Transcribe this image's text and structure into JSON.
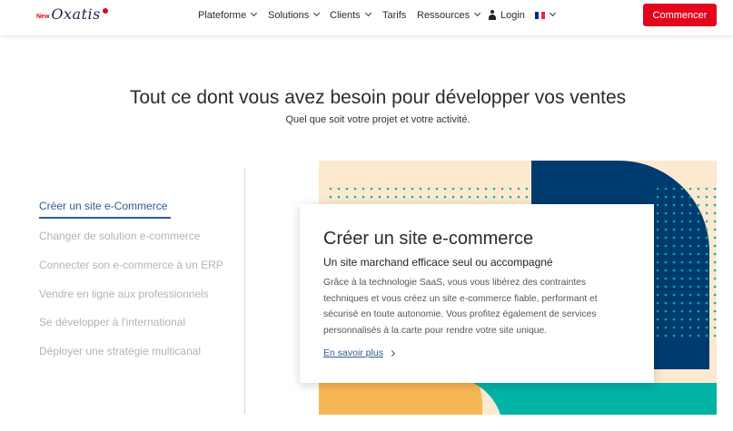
{
  "header": {
    "logo": {
      "prefix": "New",
      "name": "Oxatis"
    },
    "nav": [
      {
        "label": "Plateforme",
        "dropdown": true
      },
      {
        "label": "Solutions",
        "dropdown": true
      },
      {
        "label": "Clients",
        "dropdown": true
      },
      {
        "label": "Tarifs",
        "dropdown": false
      },
      {
        "label": "Ressources",
        "dropdown": true
      }
    ],
    "login_label": "Login",
    "language": "FR",
    "cta_label": "Commencer"
  },
  "hero": {
    "title": "Tout ce dont vous avez besoin pour développer vos ventes",
    "subtitle": "Quel que soit votre projet et votre activité."
  },
  "menu": {
    "items": [
      {
        "label": "Créer un site e-Commerce",
        "active": true
      },
      {
        "label": "Changer de solution e-commerce",
        "active": false
      },
      {
        "label": "Connecter son e-commerce à un ERP",
        "active": false
      },
      {
        "label": "Vendre en ligne aux professionnels",
        "active": false
      },
      {
        "label": "Se développer à l'international",
        "active": false
      },
      {
        "label": "Déployer une stratégie multicanal",
        "active": false
      }
    ]
  },
  "card": {
    "title": "Créer un site e-commerce",
    "subtitle": "Un site marchand efficace seul ou accompagné",
    "body": "Grâce à la technologie SaaS, vous vous libérez des contraintes techniques et vous créez un site e-commerce fiable, performant et sécurisé en toute autonomie. Vous profitez également de services personnalisés à la carte pour rendre votre site unique.",
    "link_label": "En savoir plus"
  },
  "colors": {
    "brand_red": "#e3051b",
    "accent_blue": "#2f5b92",
    "navy": "#003b6f",
    "teal": "#00b3a4",
    "peach": "#fde9d0",
    "orange": "#f7b656"
  }
}
